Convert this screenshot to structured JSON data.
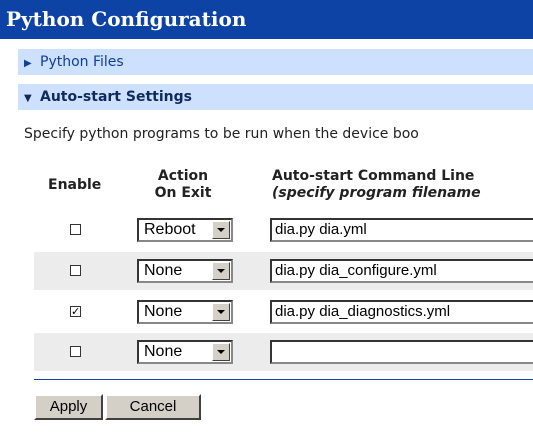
{
  "title": "Python Configuration",
  "sections": {
    "python_files": {
      "label": "Python Files",
      "expanded": false,
      "icon": "triangle-right-icon"
    },
    "auto_start": {
      "label": "Auto-start Settings",
      "expanded": true,
      "icon": "triangle-down-icon"
    }
  },
  "description": "Specify python programs to be run when the device boo",
  "columns": {
    "enable": "Enable",
    "action_line1": "Action",
    "action_line2": "On Exit",
    "command_line1": "Auto-start Command Line",
    "command_line2": "(specify program filename"
  },
  "rows": [
    {
      "enabled": false,
      "action": "Reboot",
      "command": "dia.py dia.yml"
    },
    {
      "enabled": false,
      "action": "None",
      "command": "dia.py dia_configure.yml"
    },
    {
      "enabled": true,
      "action": "None",
      "command": "dia.py dia_diagnostics.yml"
    },
    {
      "enabled": false,
      "action": "None",
      "command": ""
    }
  ],
  "buttons": {
    "apply": "Apply",
    "cancel": "Cancel"
  },
  "colors": {
    "title_bg": "#0e43a6",
    "section_bg": "#cde0fd",
    "row_alt_bg": "#ececec"
  }
}
